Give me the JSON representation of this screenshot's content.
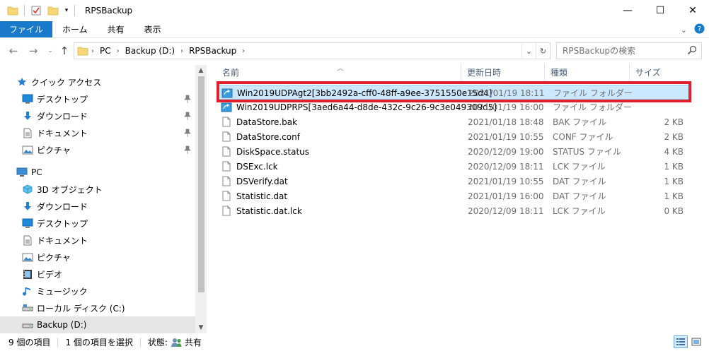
{
  "window": {
    "title": "RPSBackup",
    "min_label": "—",
    "max_label": "☐",
    "close_label": "✕"
  },
  "ribbon": {
    "tabs": [
      "ファイル",
      "ホーム",
      "共有",
      "表示"
    ]
  },
  "address": {
    "crumbs": [
      "PC",
      "Backup (D:)",
      "RPSBackup"
    ],
    "search_placeholder": "RPSBackupの検索"
  },
  "nav": {
    "items": [
      {
        "label": "クイック アクセス",
        "icon": "star-icon"
      },
      {
        "label": "デスクトップ",
        "icon": "desktop-icon",
        "pinned": true
      },
      {
        "label": "ダウンロード",
        "icon": "download-icon",
        "pinned": true
      },
      {
        "label": "ドキュメント",
        "icon": "document-icon",
        "pinned": true
      },
      {
        "label": "ピクチャ",
        "icon": "picture-icon",
        "pinned": true
      },
      {
        "label": "PC",
        "icon": "pc-icon"
      },
      {
        "label": "3D オブジェクト",
        "icon": "cube-icon"
      },
      {
        "label": "ダウンロード",
        "icon": "download-icon"
      },
      {
        "label": "デスクトップ",
        "icon": "desktop-icon"
      },
      {
        "label": "ドキュメント",
        "icon": "document-icon"
      },
      {
        "label": "ピクチャ",
        "icon": "picture-icon"
      },
      {
        "label": "ビデオ",
        "icon": "video-icon"
      },
      {
        "label": "ミュージック",
        "icon": "music-icon"
      },
      {
        "label": "ローカル ディスク (C:)",
        "icon": "drive-icon"
      },
      {
        "label": "Backup (D:)",
        "icon": "drive-icon",
        "selected": true
      }
    ]
  },
  "columns": [
    "名前",
    "更新日時",
    "種類",
    "サイズ"
  ],
  "files": [
    {
      "name": "Win2019UDPAgt2[3bb2492a-cff0-48ff-a9ee-3751550e15d4]",
      "date": "2021/01/19 18:11",
      "type": "ファイル フォルダー",
      "size": "",
      "kind": "folder",
      "selected": true
    },
    {
      "name": "Win2019UDPRPS[3aed6a44-d8de-432c-9c26-9c3e049309d5]",
      "date": "2021/01/19 16:00",
      "type": "ファイル フォルダー",
      "size": "",
      "kind": "folder"
    },
    {
      "name": "DataStore.bak",
      "date": "2021/01/18 18:48",
      "type": "BAK ファイル",
      "size": "2 KB",
      "kind": "file"
    },
    {
      "name": "DataStore.conf",
      "date": "2021/01/19 10:55",
      "type": "CONF ファイル",
      "size": "2 KB",
      "kind": "file"
    },
    {
      "name": "DiskSpace.status",
      "date": "2020/12/09 19:00",
      "type": "STATUS ファイル",
      "size": "4 KB",
      "kind": "file"
    },
    {
      "name": "DSExc.lck",
      "date": "2020/12/09 18:11",
      "type": "LCK ファイル",
      "size": "1 KB",
      "kind": "file"
    },
    {
      "name": "DSVerify.dat",
      "date": "2021/01/19 10:55",
      "type": "DAT ファイル",
      "size": "1 KB",
      "kind": "file"
    },
    {
      "name": "Statistic.dat",
      "date": "2021/01/19 16:00",
      "type": "DAT ファイル",
      "size": "1 KB",
      "kind": "file"
    },
    {
      "name": "Statistic.dat.lck",
      "date": "2020/12/09 18:11",
      "type": "LCK ファイル",
      "size": "0 KB",
      "kind": "file"
    }
  ],
  "status": {
    "item_count": "9 個の項目",
    "selected_count": "1 個の項目を選択",
    "state_label": "状態:",
    "state_value": "共有"
  },
  "colors": {
    "accent": "#1979ca",
    "selection": "#cce8ff",
    "highlight_box": "#e0202a"
  }
}
